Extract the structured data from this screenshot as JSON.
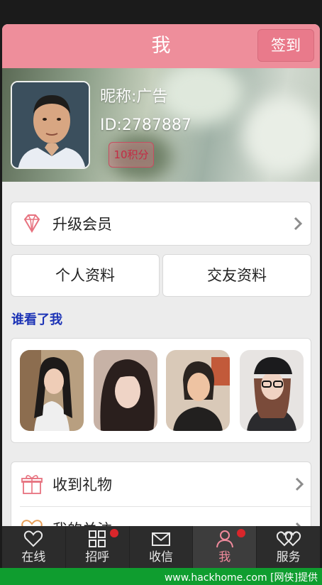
{
  "header": {
    "title": "我",
    "checkin_label": "签到"
  },
  "profile": {
    "nickname": "昵称:广告",
    "user_id": "ID:2787887",
    "points": "10积分"
  },
  "upgrade": {
    "label": "升级会员",
    "icon": "diamond-icon"
  },
  "profile_tabs": [
    {
      "label": "个人资料"
    },
    {
      "label": "交友资料"
    }
  ],
  "visitors": {
    "title": "谁看了我",
    "count": 4
  },
  "menu": [
    {
      "label": "收到礼物",
      "icon": "gift-icon"
    },
    {
      "label": "我的关注",
      "icon": "heart-icon"
    }
  ],
  "tab_bar": [
    {
      "label": "在线",
      "icon": "heart-outline-icon",
      "badge": false
    },
    {
      "label": "招呼",
      "icon": "grid-icon",
      "badge": true
    },
    {
      "label": "收信",
      "icon": "mail-icon",
      "badge": false
    },
    {
      "label": "我",
      "icon": "person-icon",
      "badge": true,
      "active": true
    },
    {
      "label": "服务",
      "icon": "double-heart-icon",
      "badge": false
    }
  ],
  "footer": {
    "watermark": "www.hackhome.com [网侠]提供"
  },
  "colors": {
    "header": "#ee8e9b",
    "accent": "#f08a9c",
    "section_title": "#1d34b6",
    "footer": "#0f9d2f",
    "badge": "#d9262b"
  }
}
